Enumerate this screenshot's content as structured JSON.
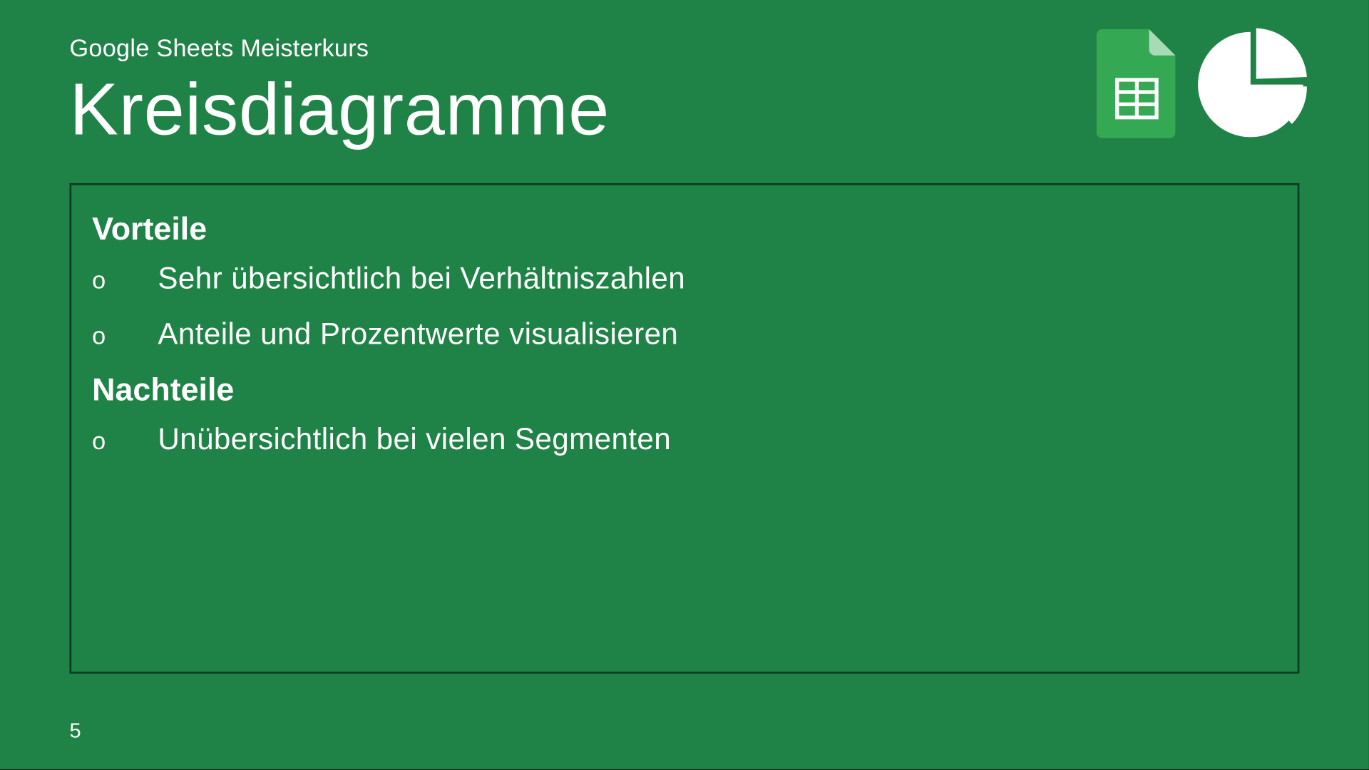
{
  "header": {
    "course": "Google Sheets Meisterkurs",
    "title": "Kreisdiagramme"
  },
  "sections": {
    "advantages": {
      "heading": "Vorteile",
      "items": [
        "Sehr übersichtlich bei Verhältniszahlen",
        "Anteile und Prozentwerte visualisieren"
      ]
    },
    "disadvantages": {
      "heading": "Nachteile",
      "items": [
        "Unübersichtlich bei vielen Segmenten"
      ]
    }
  },
  "page_number": "5",
  "bullet_marker": "o",
  "colors": {
    "slide_bg": "#1f8246",
    "box_border": "#0c3a20",
    "text": "#ffffff",
    "sheets_green": "#34a853",
    "sheets_fold": "#a8dab5"
  }
}
